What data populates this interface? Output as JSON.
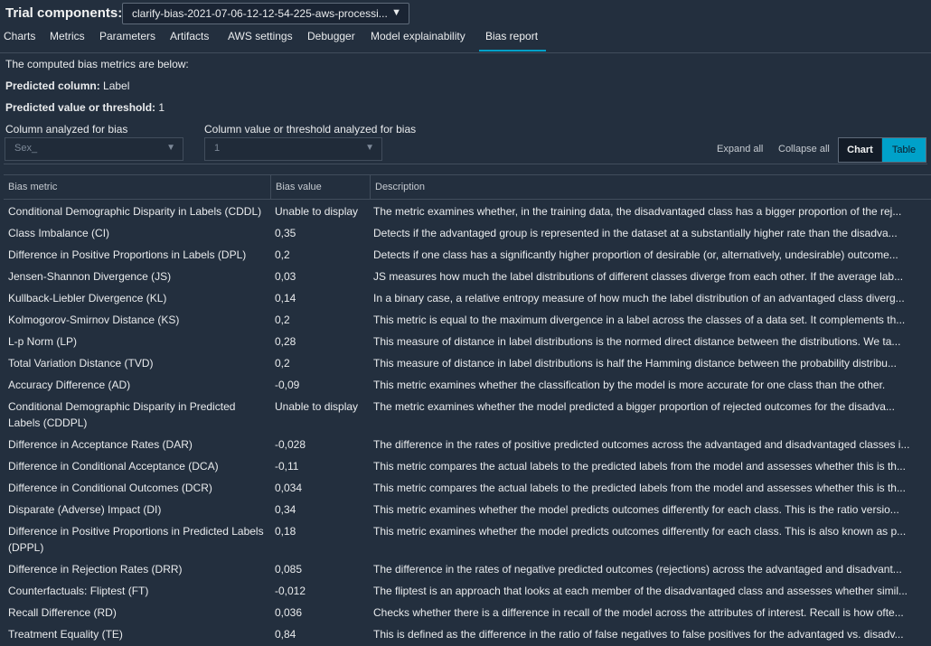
{
  "header": {
    "title": "Trial components:",
    "trial_select_value": "clarify-bias-2021-07-06-12-12-54-225-aws-processi..."
  },
  "tabs": [
    {
      "label": "Charts",
      "active": false
    },
    {
      "label": "Metrics",
      "active": false
    },
    {
      "label": "Parameters",
      "active": false
    },
    {
      "label": "Artifacts",
      "active": false
    },
    {
      "label": "AWS settings",
      "active": false
    },
    {
      "label": "Debugger",
      "active": false
    },
    {
      "label": "Model explainability",
      "active": false
    },
    {
      "label": "Bias report",
      "active": true
    }
  ],
  "intro": "The computed bias metrics are below:",
  "predicted_column": {
    "label": "Predicted column:",
    "value": "Label"
  },
  "predicted_value": {
    "label": "Predicted value or threshold:",
    "value": "1"
  },
  "filters": {
    "column_label": "Column analyzed for bias",
    "column_value": "Sex_",
    "threshold_label": "Column value or threshold analyzed for bias",
    "threshold_value": "1"
  },
  "actions": {
    "expand_all": "Expand all",
    "collapse_all": "Collapse all",
    "chart": "Chart",
    "table": "Table",
    "selected_view": "Table"
  },
  "table": {
    "headers": [
      "Bias metric",
      "Bias value",
      "Description"
    ],
    "rows": [
      {
        "metric": "Conditional Demographic Disparity in Labels (CDDL)",
        "value": "Unable to display",
        "description": "The metric examines whether, in the training data, the disadvantaged class has a bigger proportion of the rej..."
      },
      {
        "metric": "Class Imbalance (CI)",
        "value": "0,35",
        "description": "Detects if the advantaged group is represented in the dataset at a substantially higher rate than the disadva..."
      },
      {
        "metric": "Difference in Positive Proportions in Labels (DPL)",
        "value": "0,2",
        "description": "Detects if one class has a significantly higher proportion of desirable (or, alternatively, undesirable) outcome..."
      },
      {
        "metric": "Jensen-Shannon Divergence (JS)",
        "value": "0,03",
        "description": "JS measures how much the label distributions of different classes diverge from each other. If the average lab..."
      },
      {
        "metric": "Kullback-Liebler Divergence (KL)",
        "value": "0,14",
        "description": "In a binary case, a relative entropy measure of how much the label distribution of an advantaged class diverg..."
      },
      {
        "metric": "Kolmogorov-Smirnov Distance (KS)",
        "value": "0,2",
        "description": "This metric is equal to the maximum divergence in a label across the classes of a data set. It complements th..."
      },
      {
        "metric": "L-p Norm (LP)",
        "value": "0,28",
        "description": "This measure of distance in label distributions is the normed direct distance between the distributions. We ta..."
      },
      {
        "metric": "Total Variation Distance (TVD)",
        "value": "0,2",
        "description": "This measure of distance in label distributions is half the Hamming distance between the probability distribu..."
      },
      {
        "metric": "Accuracy Difference (AD)",
        "value": "-0,09",
        "description": "This metric examines whether the classification by the model is more accurate for one class than the other."
      },
      {
        "metric": "Conditional Demographic Disparity in Predicted Labels (CDDPL)",
        "value": "Unable to display",
        "description": "The metric examines whether the model predicted a bigger proportion of rejected outcomes for the disadva..."
      },
      {
        "metric": "Difference in Acceptance Rates (DAR)",
        "value": "-0,028",
        "description": "The difference in the rates of positive predicted outcomes across the advantaged and disadvantaged classes i..."
      },
      {
        "metric": "Difference in Conditional Acceptance (DCA)",
        "value": "-0,11",
        "description": "This metric compares the actual labels to the predicted labels from the model and assesses whether this is th..."
      },
      {
        "metric": "Difference in Conditional Outcomes (DCR)",
        "value": "0,034",
        "description": "This metric compares the actual labels to the predicted labels from the model and assesses whether this is th..."
      },
      {
        "metric": "Disparate (Adverse) Impact (DI)",
        "value": "0,34",
        "description": "This metric examines whether the model predicts outcomes differently for each class. This is the ratio versio..."
      },
      {
        "metric": "Difference in Positive Proportions in Predicted Labels (DPPL)",
        "value": "0,18",
        "description": "This metric examines whether the model predicts outcomes differently for each class. This is also known as p..."
      },
      {
        "metric": "Difference in Rejection Rates (DRR)",
        "value": "0,085",
        "description": "The difference in the rates of negative predicted outcomes (rejections) across the advantaged and disadvant..."
      },
      {
        "metric": "Counterfactuals: Fliptest (FT)",
        "value": "-0,012",
        "description": "The fliptest is an approach that looks at each member of the disadvantaged class and assesses whether simil..."
      },
      {
        "metric": "Recall Difference (RD)",
        "value": "0,036",
        "description": "Checks whether there is a difference in recall of the model across the attributes of interest. Recall is how ofte..."
      },
      {
        "metric": "Treatment Equality (TE)",
        "value": "0,84",
        "description": "This is defined as the difference in the ratio of false negatives to false positives for the advantaged vs. disadv..."
      }
    ]
  }
}
